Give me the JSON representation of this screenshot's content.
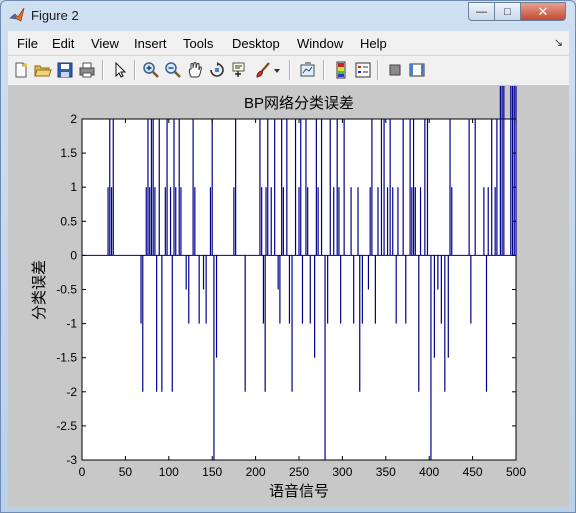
{
  "window": {
    "title": "Figure 2",
    "minimize_glyph": "—",
    "maximize_glyph": "□",
    "close_glyph": "✕"
  },
  "menu": {
    "items": [
      "File",
      "Edit",
      "View",
      "Insert",
      "Tools",
      "Desktop",
      "Window",
      "Help"
    ],
    "overflow_glyph": "↘"
  },
  "toolbar": {
    "icons": [
      "new-figure-icon",
      "open-file-icon",
      "save-icon",
      "print-icon",
      "pointer-icon",
      "zoom-in-icon",
      "zoom-out-icon",
      "pan-icon",
      "rotate-3d-icon",
      "data-cursor-icon",
      "brush-icon",
      "link-plot-icon",
      "colorbar-icon",
      "legend-icon",
      "hide-plot-tools-icon",
      "show-plot-tools-icon"
    ]
  },
  "chart_data": {
    "type": "line",
    "title": "BP网络分类误差",
    "xlabel": "语音信号",
    "ylabel": "分类误差",
    "xlim": [
      0,
      500
    ],
    "ylim": [
      -3,
      2
    ],
    "xticks": [
      0,
      50,
      100,
      150,
      200,
      250,
      300,
      350,
      400,
      450,
      500
    ],
    "yticks": [
      -3,
      -2.5,
      -2,
      -1.5,
      -1,
      -0.5,
      0,
      0.5,
      1,
      1.5,
      2
    ],
    "ytick_labels": [
      "-3",
      "-2.5",
      "-2",
      "-1.5",
      "-1",
      "-0.5",
      "0",
      "0.5",
      "1",
      "1.5",
      "2"
    ],
    "grid": false,
    "line_color": "#00008b",
    "series": [
      {
        "spikes_x": [
          30,
          32,
          34,
          36,
          68,
          70,
          74,
          76,
          78,
          80,
          82,
          84,
          86,
          89,
          92,
          96,
          98,
          102,
          104,
          106,
          108,
          112,
          114,
          120,
          123,
          128,
          130,
          135,
          140,
          143,
          148,
          150,
          152,
          155,
          175,
          177,
          188,
          205,
          207,
          209,
          211,
          212,
          214,
          218,
          222,
          226,
          228,
          230,
          232,
          236,
          239,
          242,
          246,
          250,
          252,
          254,
          258,
          260,
          263,
          268,
          270,
          272,
          276,
          280,
          283,
          286,
          290,
          294,
          296,
          298,
          302,
          310,
          313,
          318,
          320,
          323,
          330,
          332,
          334,
          338,
          341,
          345,
          348,
          352,
          355,
          358,
          362,
          364,
          370,
          373,
          378,
          380,
          382,
          384,
          388,
          390,
          395,
          398,
          402,
          406,
          410,
          414,
          418,
          422,
          424,
          426,
          446,
          448,
          453,
          463,
          466,
          468,
          472,
          476,
          478,
          482,
          484,
          486,
          494,
          496,
          498,
          500
        ],
        "spikes_y": [
          1,
          2,
          1,
          2,
          -1,
          -2,
          1,
          2,
          1,
          2,
          2,
          1,
          -2,
          2,
          -2,
          1,
          2,
          1,
          -2,
          2,
          1,
          2,
          1,
          -0.5,
          -1,
          2,
          1,
          -1,
          -0.5,
          -1,
          1,
          2,
          -3,
          -1.5,
          1,
          2,
          -2,
          2,
          1,
          -1,
          -2,
          1,
          2,
          1,
          2,
          -0.5,
          -1,
          2,
          1,
          2,
          -1,
          -2,
          2,
          1,
          2,
          -1,
          2,
          1,
          -1,
          -1.5,
          2,
          1,
          2,
          -3,
          -1,
          2,
          1,
          2,
          1,
          -1,
          2,
          1,
          -1,
          1,
          -2,
          -1,
          -0.5,
          1,
          2,
          -1,
          1,
          2,
          2,
          1,
          2,
          1,
          -1,
          1,
          2,
          -1,
          2,
          1,
          2,
          1,
          -2,
          1,
          2,
          2,
          -3,
          -1.5,
          -0.5,
          -1,
          -2,
          -1.5,
          2,
          1,
          2,
          -1,
          2,
          1,
          -2,
          1,
          2,
          1,
          2
        ],
        "note_nonzero_only": true
      }
    ]
  }
}
